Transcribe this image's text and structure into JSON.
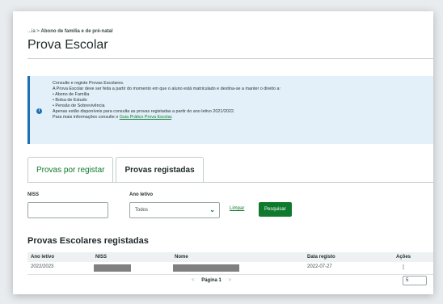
{
  "breadcrumb": {
    "prefix": "...ia",
    "separator": ">",
    "current": "Abono de família e de pré-natal"
  },
  "page": {
    "title": "Prova Escolar"
  },
  "info": {
    "icon": "info-icon",
    "line1": "Consulte e registe Provas Escolares.",
    "line2": "A Prova Escolar deve ser feita a partir do momento em que o aluno está matriculado e destina-se a manter o direito a:",
    "items": [
      "Abono de Família",
      "Bolsa de Estudo",
      "Pensão de Sobrevivência"
    ],
    "line3": "Apenas estão disponíveis para consulta as provas registadas a partir do ano letivo 2021/2022.",
    "line4_prefix": "Para mais informações consulte o",
    "line4_link": "Guia Prático Prova Escolar",
    "line4_suffix": "."
  },
  "tabs": [
    {
      "label": "Provas por registar",
      "active": false
    },
    {
      "label": "Provas registadas",
      "active": true
    }
  ],
  "filters": {
    "niss_label": "NISS",
    "niss_value": "",
    "ano_label": "Ano letivo",
    "ano_value": "Todos",
    "clear_label": "Limpar",
    "search_label": "Pesquisar"
  },
  "table": {
    "title": "Provas Escolares registadas",
    "columns": [
      "Ano letivo",
      "NISS",
      "Nome",
      "Data registo",
      "Ações"
    ],
    "rows": [
      {
        "ano": "2022/2023",
        "data": "2022-07-27",
        "acoes": "⋮"
      }
    ]
  },
  "pagination": {
    "prev": "<",
    "label": "Página 1",
    "next": ">",
    "page_size": "5"
  },
  "colors": {
    "accent": "#0f7a2d",
    "info_bg": "#e3f0f9",
    "info_border": "#1f6fb5"
  }
}
